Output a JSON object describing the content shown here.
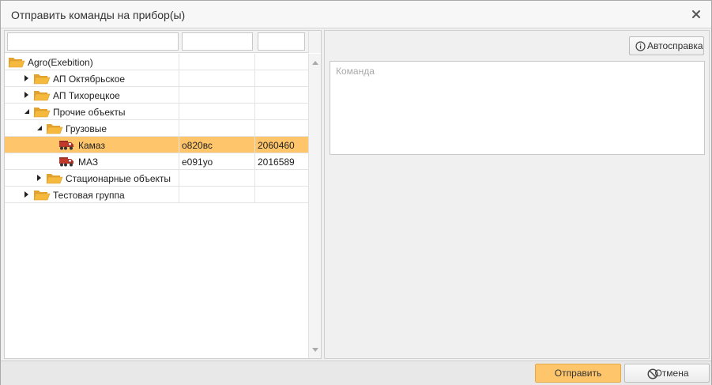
{
  "dialog": {
    "title": "Отправить команды на прибор(ы)"
  },
  "filters": {
    "name_value": "",
    "col2_value": "",
    "col3_value": ""
  },
  "tree": {
    "rows": [
      {
        "label": "Agro(Exebition)",
        "col2": "",
        "col3": "",
        "level": 0,
        "expander": "none",
        "icon": "folder-open-icon",
        "selected": false
      },
      {
        "label": "АП Октябрьское",
        "col2": "",
        "col3": "",
        "level": 1,
        "expander": "collapsed",
        "icon": "folder-open-icon",
        "selected": false
      },
      {
        "label": "АП Тихорецкое",
        "col2": "",
        "col3": "",
        "level": 1,
        "expander": "collapsed",
        "icon": "folder-open-icon",
        "selected": false
      },
      {
        "label": "Прочие объекты",
        "col2": "",
        "col3": "",
        "level": 1,
        "expander": "expanded",
        "icon": "folder-open-icon",
        "selected": false
      },
      {
        "label": "Грузовые",
        "col2": "",
        "col3": "",
        "level": 2,
        "expander": "expanded",
        "icon": "folder-open-icon",
        "selected": false
      },
      {
        "label": "Камаз",
        "col2": "о820вс",
        "col3": "2060460",
        "level": 3,
        "expander": "none",
        "icon": "truck-icon",
        "selected": true
      },
      {
        "label": "МАЗ",
        "col2": "е091уо",
        "col3": "2016589",
        "level": 3,
        "expander": "none",
        "icon": "truck-icon",
        "selected": false
      },
      {
        "label": "Стационарные объекты",
        "col2": "",
        "col3": "",
        "level": 2,
        "expander": "collapsed",
        "icon": "folder-open-icon",
        "selected": false
      },
      {
        "label": "Тестовая группа",
        "col2": "",
        "col3": "",
        "level": 1,
        "expander": "collapsed",
        "icon": "folder-open-icon",
        "selected": false
      }
    ]
  },
  "right": {
    "help_label": "Автосправка",
    "command_placeholder": "Команда",
    "command_value": ""
  },
  "footer": {
    "send_label": "Отправить",
    "cancel_label": "Отмена"
  },
  "colors": {
    "selected_row": "#ffc56b",
    "send_button": "#ffc56b",
    "folder": "#f5b93e"
  }
}
